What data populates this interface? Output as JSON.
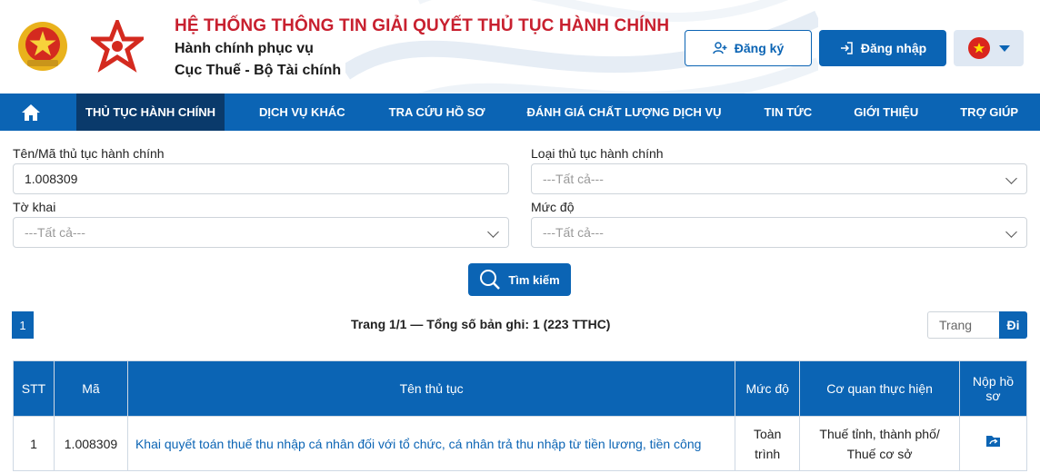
{
  "header": {
    "title": "HỆ THỐNG THÔNG TIN GIẢI QUYẾT THỦ TỤC HÀNH CHÍNH",
    "subtitle1": "Hành chính phục vụ",
    "subtitle2": "Cục Thuế - Bộ Tài chính",
    "register_label": "Đăng ký",
    "login_label": "Đăng nhập"
  },
  "nav": {
    "items": [
      {
        "label": "THỦ TỤC HÀNH CHÍNH",
        "active": true
      },
      {
        "label": "DỊCH VỤ KHÁC"
      },
      {
        "label": "TRA CỨU HỒ SƠ"
      },
      {
        "label": "ĐÁNH GIÁ CHẤT LƯỢNG DỊCH VỤ"
      },
      {
        "label": "TIN TỨC"
      },
      {
        "label": "GIỚI THIỆU"
      },
      {
        "label": "TRỢ GIÚP"
      }
    ]
  },
  "form": {
    "name_label": "Tên/Mã thủ tục hành chính",
    "name_value": "1.008309",
    "type_label": "Loại thủ tục hành chính",
    "type_value": "---Tất cả---",
    "declaration_label": "Tờ khai",
    "declaration_value": "---Tất cả---",
    "level_label": "Mức độ",
    "level_value": "---Tất cả---",
    "search_label": "Tìm kiếm"
  },
  "pagination": {
    "current_page": "1",
    "info": "Trang 1/1 — Tổng số bản ghi: 1 (223 TTHC)",
    "page_placeholder": "Trang",
    "go_label": "Đi"
  },
  "table": {
    "headers": [
      "STT",
      "Mã",
      "Tên thủ tục",
      "Mức độ",
      "Cơ quan thực hiện",
      "Nộp hồ sơ"
    ],
    "rows": [
      {
        "stt": "1",
        "code": "1.008309",
        "name": "Khai quyết toán thuế thu nhập cá nhân đối với tổ chức, cá nhân trả thu nhập từ tiền lương, tiền công",
        "level": "Toàn trình",
        "agency": "Thuế tỉnh, thành phố/ Thuế cơ sở"
      }
    ]
  },
  "colors": {
    "primary": "#0b64b4",
    "nav_active": "#0a3a6b",
    "title_red": "#c8202f"
  }
}
